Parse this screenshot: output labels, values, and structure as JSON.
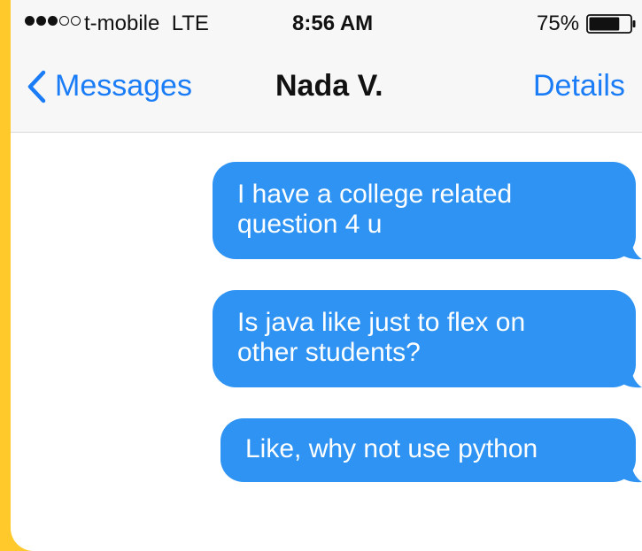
{
  "status_bar": {
    "signal_icon": "signal-strength-icon",
    "carrier": "t-mobile",
    "network": "LTE",
    "time": "8:56 AM",
    "battery_percent": "75%",
    "battery_level": 0.75
  },
  "nav": {
    "back_label": "Messages",
    "title": "Nada V.",
    "details_label": "Details"
  },
  "messages": [
    {
      "sender": "me",
      "text_lines": [
        "I have a college related",
        "question 4 u"
      ]
    },
    {
      "sender": "me",
      "text_lines": [
        "Is java like just to flex on",
        "other students?"
      ]
    },
    {
      "sender": "me",
      "text_lines": [
        "Like, why not use python"
      ]
    }
  ],
  "colors": {
    "frame": "#FFC92B",
    "accent": "#1A7CF6",
    "bubble": "#2E93F3"
  }
}
